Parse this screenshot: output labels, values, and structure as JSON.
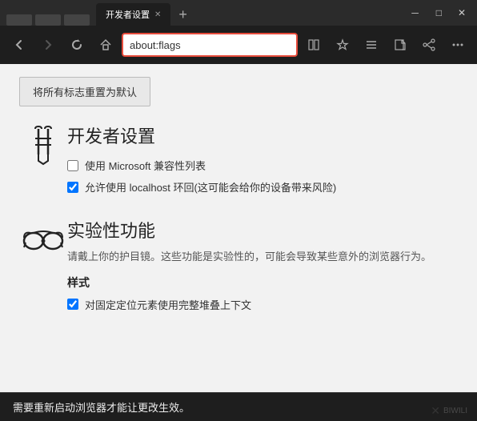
{
  "titlebar": {
    "tabs": [
      {
        "label": "开发者设置",
        "active": true,
        "closable": true
      }
    ],
    "new_tab_symbol": "+",
    "window_controls": [
      "—",
      "□",
      "✕"
    ]
  },
  "navbar": {
    "back_title": "后退",
    "forward_title": "前进",
    "refresh_title": "刷新",
    "home_title": "主页",
    "address": "about:flags",
    "reading_icon": "📖",
    "favorite_icon": "☆",
    "hub_icon": "≡",
    "note_icon": "✏",
    "share_icon": "◁",
    "more_icon": "…"
  },
  "content": {
    "reset_button_label": "将所有标志重置为默认",
    "dev_section": {
      "title": "开发者设置",
      "checkbox1_label": "使用 Microsoft 兼容性列表",
      "checkbox1_checked": false,
      "checkbox2_label": "允许使用 localhost 环回(这可能会给你的设备带来风险)",
      "checkbox2_checked": true
    },
    "exp_section": {
      "title": "实验性功能",
      "description": "请戴上你的护目镜。这些功能是实验性的，可能会导致某些意外的浏览器行为。",
      "sub_title": "样式",
      "checkbox1_label": "对固定定位元素使用完整堆叠上下文",
      "checkbox1_checked": true
    }
  },
  "statusbar": {
    "text": "需要重新启动浏览器才能让更改生效。"
  }
}
